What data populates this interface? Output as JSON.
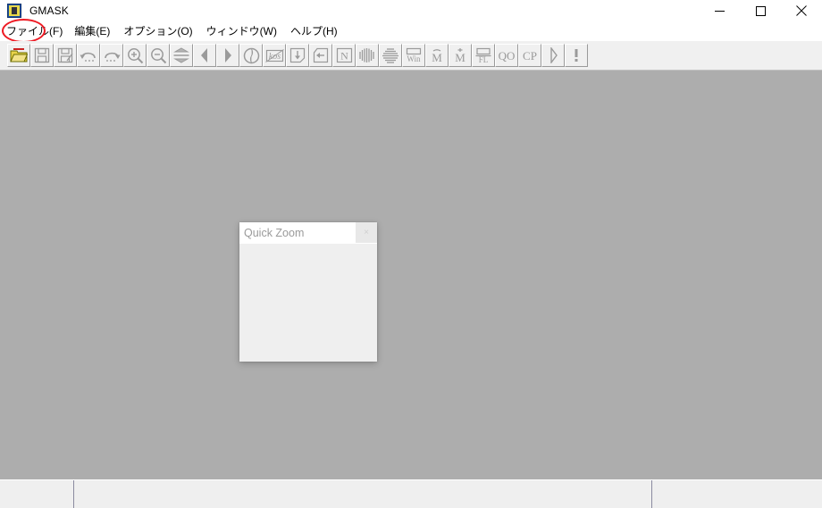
{
  "window": {
    "title": "GMASK",
    "icon": "gmask-app-icon",
    "controls": [
      {
        "name": "minimize",
        "glyph": "minimize-icon"
      },
      {
        "name": "maximize",
        "glyph": "maximize-icon"
      },
      {
        "name": "close",
        "glyph": "close-icon"
      }
    ]
  },
  "menubar": {
    "items": [
      {
        "label": "ファイル(F)",
        "name": "menu-file",
        "annotated": true
      },
      {
        "label": "編集(E)",
        "name": "menu-edit",
        "annotated": false
      },
      {
        "label": "オプション(O)",
        "name": "menu-options",
        "annotated": false
      },
      {
        "label": "ウィンドウ(W)",
        "name": "menu-window",
        "annotated": false
      },
      {
        "label": "ヘルプ(H)",
        "name": "menu-help",
        "annotated": false
      }
    ]
  },
  "annotation": {
    "type": "ellipse",
    "color": "#ee1b24",
    "target": "menu-file"
  },
  "toolbar": {
    "buttons": [
      {
        "name": "open-folder-icon",
        "tip": "開く",
        "enabled": true
      },
      {
        "name": "save-icon",
        "tip": "保存",
        "enabled": false
      },
      {
        "name": "save-as-icon",
        "tip": "名前を付けて保存",
        "enabled": false
      },
      {
        "name": "undo-icon",
        "tip": "元に戻す",
        "enabled": false
      },
      {
        "name": "redo-icon",
        "tip": "やり直し",
        "enabled": false
      },
      {
        "name": "zoom-in-icon",
        "tip": "拡大",
        "enabled": false
      },
      {
        "name": "zoom-out-icon",
        "tip": "縮小",
        "enabled": false
      },
      {
        "name": "fit-vertical-icon",
        "tip": "縦に合わせる",
        "enabled": false
      },
      {
        "name": "previous-page-icon",
        "tip": "前へ",
        "enabled": false
      },
      {
        "name": "next-page-icon",
        "tip": "次へ",
        "enabled": false
      },
      {
        "name": "rotate-icon",
        "tip": "回転",
        "enabled": false
      },
      {
        "name": "mask-kor-icon",
        "tip": "マスク",
        "enabled": false
      },
      {
        "name": "insert-down-icon",
        "tip": "挿入",
        "enabled": false
      },
      {
        "name": "insert-left-icon",
        "tip": "戻す",
        "enabled": false
      },
      {
        "name": "n-box-icon",
        "tip": "N",
        "enabled": false
      },
      {
        "name": "vertical-lines-icon",
        "tip": "縦線",
        "enabled": false
      },
      {
        "name": "horizontal-lines-icon",
        "tip": "横線",
        "enabled": false
      },
      {
        "name": "win-icon",
        "tip": "Win",
        "enabled": false
      },
      {
        "name": "m-bar-icon",
        "tip": "M",
        "enabled": false
      },
      {
        "name": "m-dot-icon",
        "tip": "M",
        "enabled": false
      },
      {
        "name": "fl-icon",
        "tip": "FL",
        "enabled": false
      },
      {
        "name": "qo-icon",
        "tip": "QO",
        "enabled": false
      },
      {
        "name": "cp-icon",
        "tip": "CP",
        "enabled": false
      },
      {
        "name": "play-icon",
        "tip": "実行",
        "enabled": false
      },
      {
        "name": "info-icon",
        "tip": "情報",
        "enabled": false
      }
    ]
  },
  "quick_zoom": {
    "title": "Quick Zoom",
    "close_label": "×",
    "body_text": ""
  },
  "statusbar": {
    "panels": [
      {
        "name": "status-panel-left",
        "text": ""
      },
      {
        "name": "status-panel-center",
        "text": ""
      },
      {
        "name": "status-panel-right",
        "text": ""
      }
    ]
  },
  "colors": {
    "canvas": "#adadad",
    "toolbar": "#f0f0f0",
    "statusbar": "#efefef",
    "annotation": "#ee1b24",
    "folder_icon": "#c8b400"
  }
}
